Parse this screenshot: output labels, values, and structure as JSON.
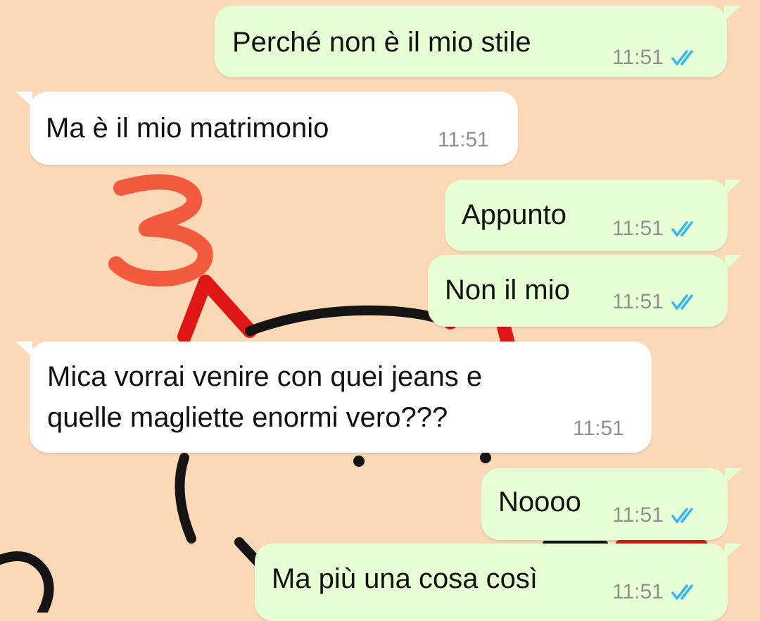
{
  "chat": {
    "messages": [
      {
        "direction": "out",
        "text": "Perché non è il mio stile",
        "time": "11:51",
        "status_icon": "double-check-read-icon"
      },
      {
        "direction": "in",
        "text": "Ma è il mio matrimonio",
        "time": "11:51"
      },
      {
        "direction": "out",
        "text": "Appunto",
        "time": "11:51",
        "status_icon": "double-check-read-icon"
      },
      {
        "direction": "out",
        "text": "Non il mio",
        "time": "11:51",
        "status_icon": "double-check-read-icon"
      },
      {
        "direction": "in",
        "text_line1": "Mica vorrai venire con quei jeans e",
        "text_line2": "quelle magliette enormi vero???",
        "time": "11:51"
      },
      {
        "direction": "out",
        "text": "Noooo",
        "time": "11:51",
        "status_icon": "double-check-read-icon"
      },
      {
        "direction": "out",
        "text": "Ma più una cosa così",
        "time": "11:51",
        "status_icon": "double-check-read-icon"
      }
    ]
  },
  "overlay": {
    "number": "3",
    "color": "#f15a3c"
  },
  "colors": {
    "wallpaper": "#fbd9b6",
    "outgoing_bubble": "#e6ffd4",
    "incoming_bubble": "#ffffff",
    "read_ticks": "#34b7f1",
    "timestamp": "#8f8f8f",
    "cat_ears": "#e01616",
    "cat_outline": "#141414"
  }
}
